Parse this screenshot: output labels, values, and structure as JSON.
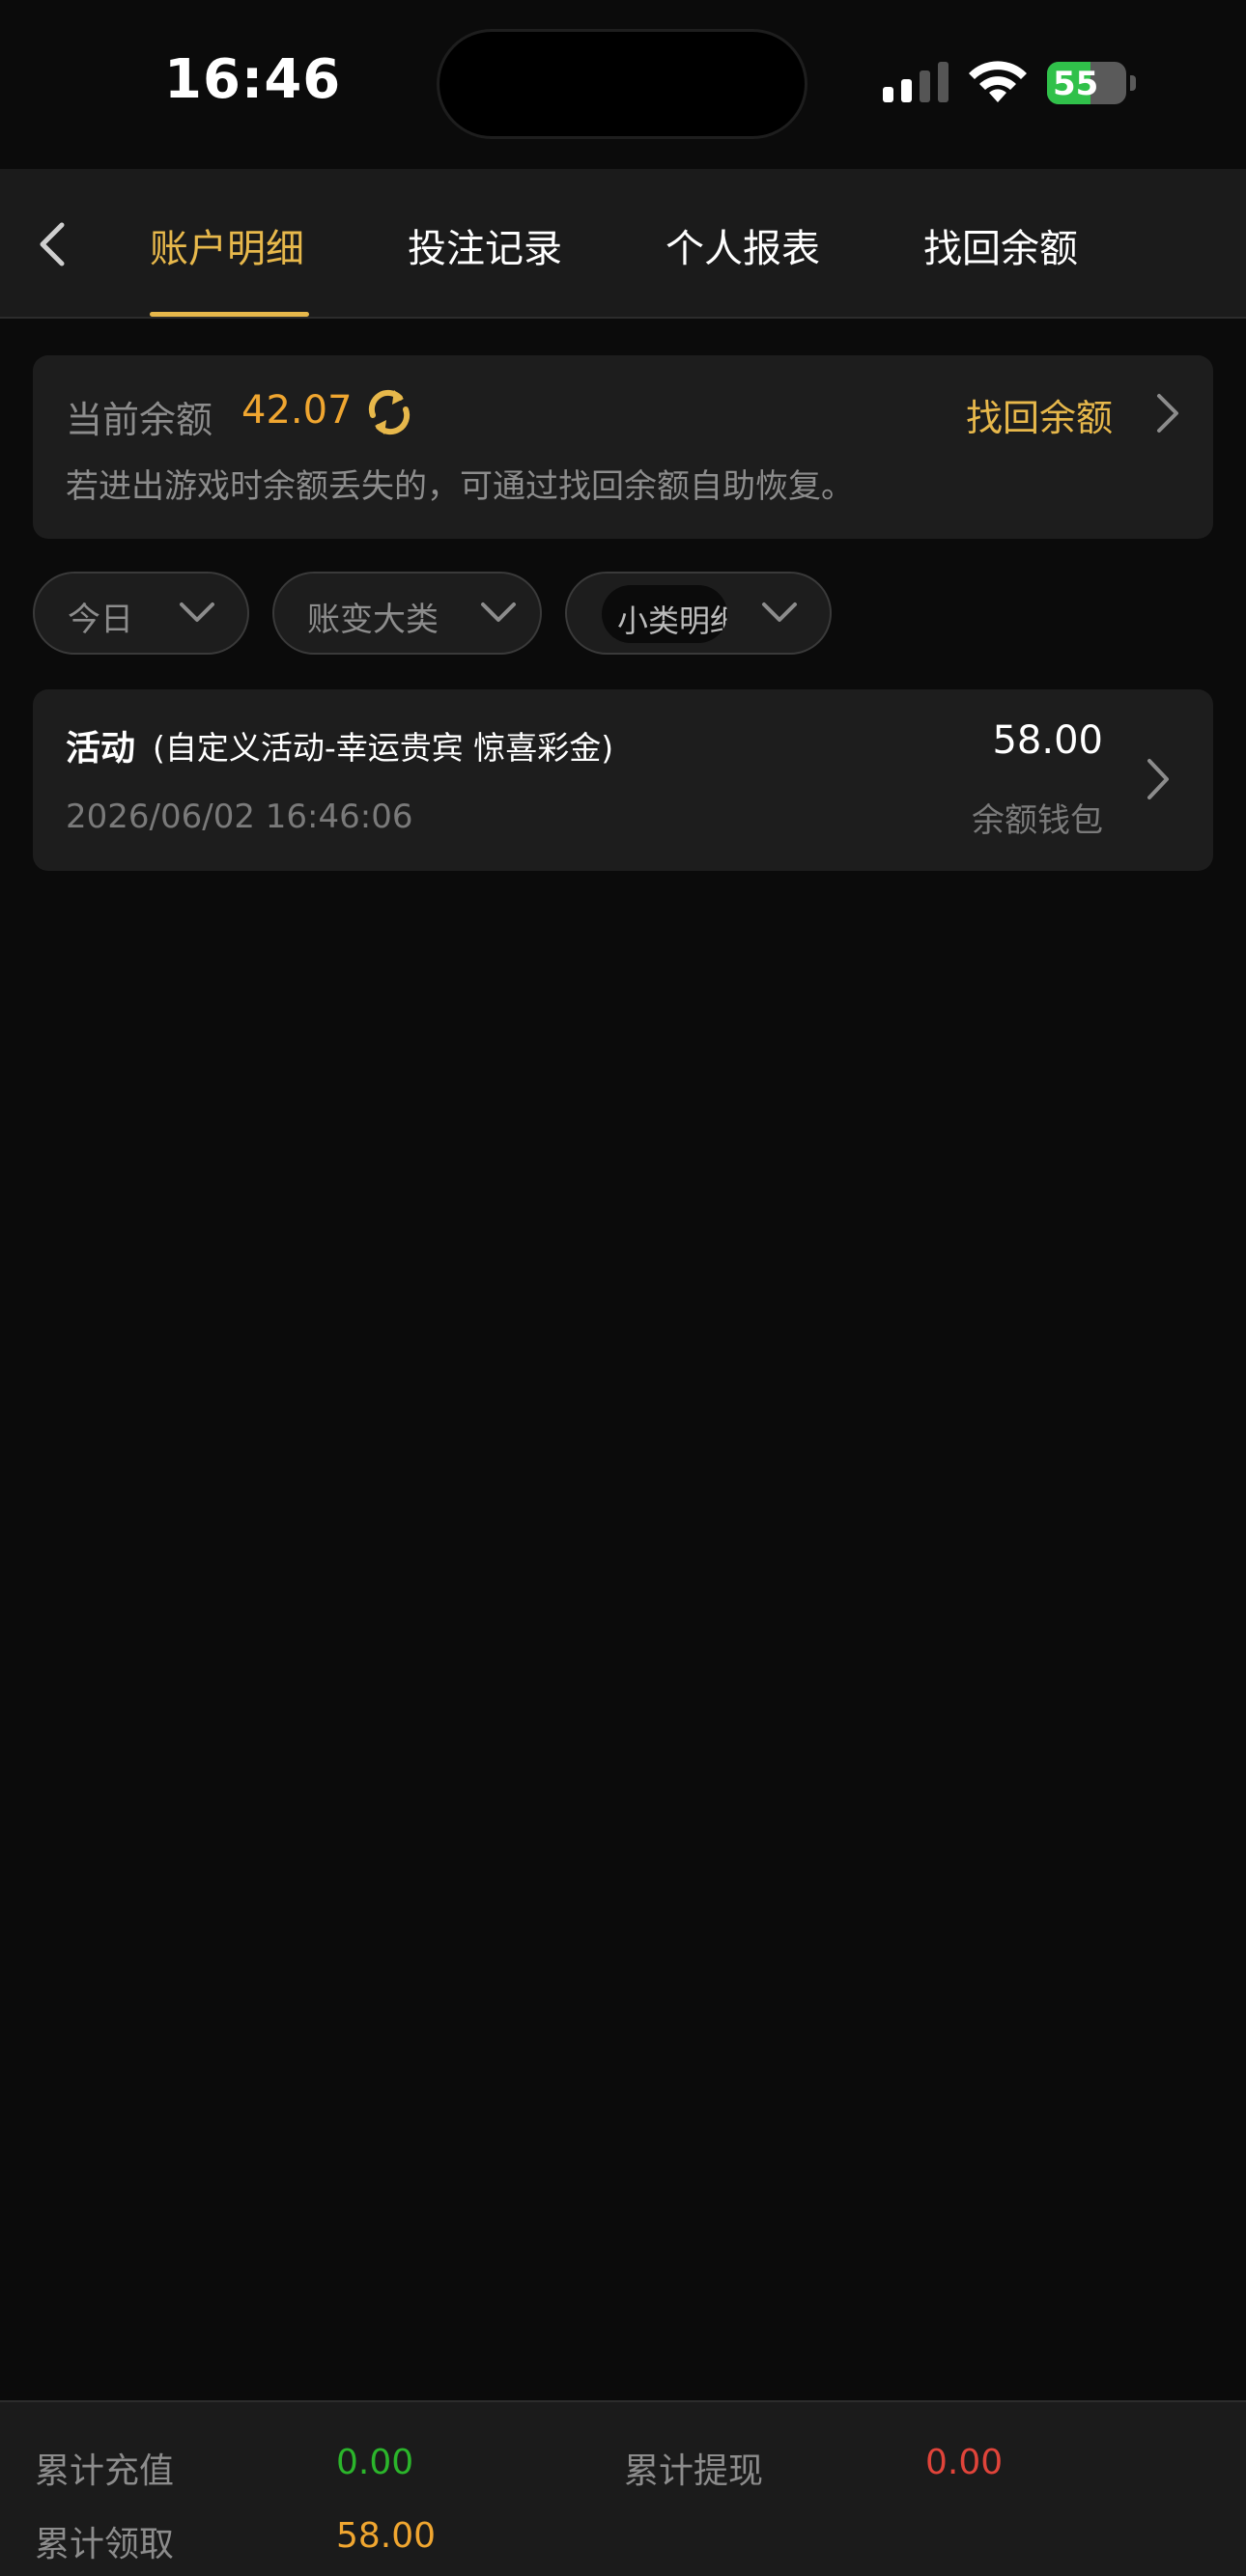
{
  "status_bar": {
    "time": "16:46",
    "battery": "55",
    "battery_level": 0.55
  },
  "nav": {
    "tabs": [
      {
        "label": "账户明细",
        "active": true
      },
      {
        "label": "投注记录",
        "active": false
      },
      {
        "label": "个人报表",
        "active": false
      },
      {
        "label": "找回余额",
        "active": false
      }
    ]
  },
  "balance": {
    "label": "当前余额",
    "value": "42.07",
    "recover_label": "找回余额",
    "hint": "若进出游戏时余额丢失的，可通过找回余额自助恢复。"
  },
  "filters": {
    "date": "今日",
    "category": "账变大类",
    "subcategory": "小类明细"
  },
  "records": [
    {
      "type": "活动",
      "description": "(自定义活动-幸运贵宾 惊喜彩金)",
      "time": "2026/06/02 16:46:06",
      "amount": "58.00",
      "wallet": "余额钱包"
    }
  ],
  "summary": {
    "deposit_label": "累计充值",
    "deposit_value": "0.00",
    "withdraw_label": "累计提现",
    "withdraw_value": "0.00",
    "claim_label": "累计领取",
    "claim_value": "58.00"
  },
  "colors": {
    "accent": "#e7b84b",
    "balance": "#f0a630",
    "green": "#2bb52b",
    "red": "#e0443a",
    "background": "#0b0b0b",
    "card": "#1d1d1d"
  }
}
